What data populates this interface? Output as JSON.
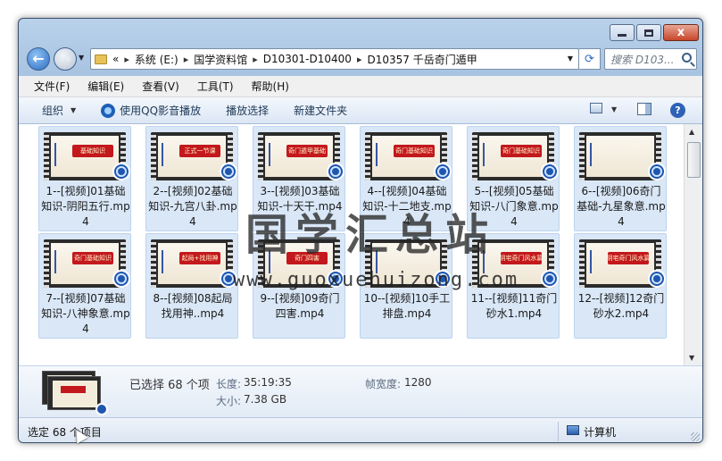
{
  "window": {
    "minimize_glyph": "",
    "close_glyph": "x"
  },
  "nav": {
    "breadcrumb_prefix": "«",
    "breadcrumbs": [
      "系统 (E:)",
      "国学资料馆",
      "D10301-D10400",
      "D10357 千岳奇门遁甲"
    ],
    "search_placeholder": "搜索 D103..."
  },
  "menu": [
    "文件(F)",
    "编辑(E)",
    "查看(V)",
    "工具(T)",
    "帮助(H)"
  ],
  "toolbar": {
    "organize": "组织",
    "play_qq": "使用QQ影音播放",
    "play_selection": "播放选择",
    "new_folder": "新建文件夹",
    "help": "?"
  },
  "files": [
    {
      "label": "1--[视频]01基础知识-阴阳五行.mp4",
      "thumb_title": "基础知识"
    },
    {
      "label": "2--[视频]02基础知识-九宫八卦.mp4",
      "thumb_title": "正式一节课"
    },
    {
      "label": "3--[视频]03基础知识-十天干.mp4",
      "thumb_title": "奇门遁甲基础"
    },
    {
      "label": "4--[视频]04基础知识-十二地支.mp4",
      "thumb_title": "奇门基础知识"
    },
    {
      "label": "5--[视频]05基础知识-八门象意.mp4",
      "thumb_title": "奇门基础知识"
    },
    {
      "label": "6--[视频]06奇门基础-九星象意.mp4",
      "thumb_title": ""
    },
    {
      "label": "7--[视频]07基础知识-八神象意.mp4",
      "thumb_title": "奇门基础知识"
    },
    {
      "label": "8--[视频]08起局找用神..mp4",
      "thumb_title": "起局+找用神"
    },
    {
      "label": "9--[视频]09奇门四害.mp4",
      "thumb_title": "奇门四害"
    },
    {
      "label": "10--[视频]10手工排盘.mp4",
      "thumb_title": ""
    },
    {
      "label": "11--[视频]11奇门砂水1.mp4",
      "thumb_title": "阴宅奇门风水篇"
    },
    {
      "label": "12--[视频]12奇门砂水2.mp4",
      "thumb_title": "阴宅奇门风水篇"
    }
  ],
  "details": {
    "selected": "已选择 68 个项",
    "length_key": "长度:",
    "length_val": "35:19:35",
    "size_key": "大小:",
    "size_val": "7.38 GB",
    "framewidth_key": "帧宽度:",
    "framewidth_val": "1280"
  },
  "status": {
    "left": "选定 68 个项目",
    "right": "计算机"
  },
  "watermark": {
    "title": "国学汇总站",
    "url": "www.guoxuehuizong.com"
  }
}
